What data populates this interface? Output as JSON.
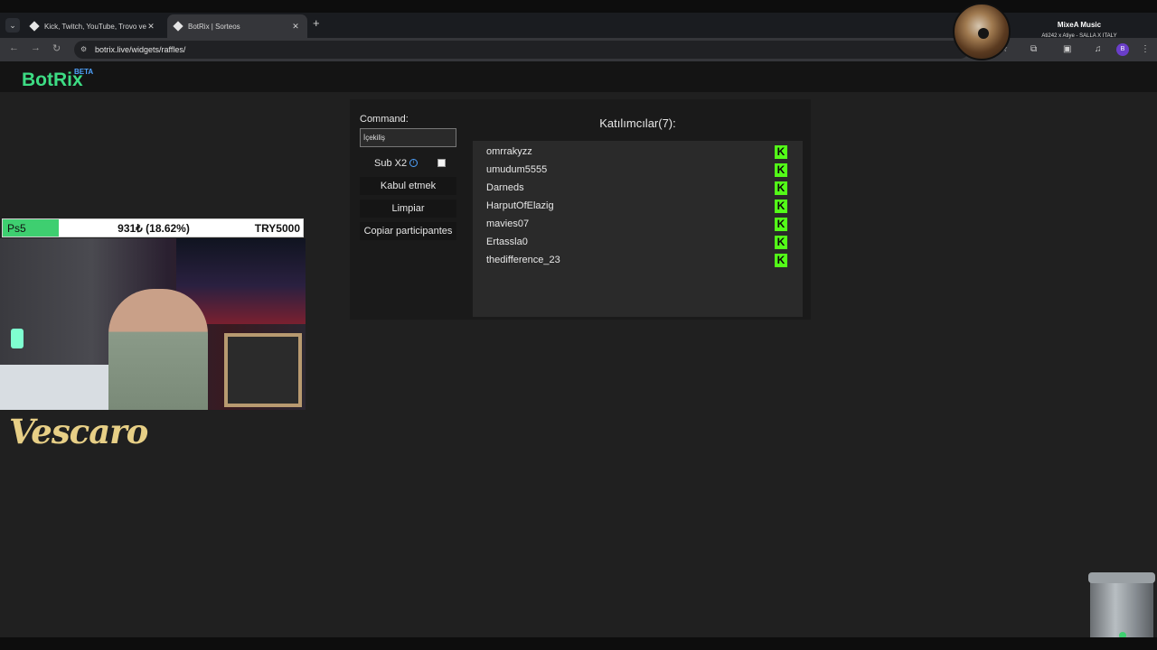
{
  "browser": {
    "tabs": [
      {
        "label": "Kick, Twitch, YouTube, Trovo ve"
      },
      {
        "label": "BotRix | Sorteos"
      }
    ],
    "url": "botrix.live/widgets/raffles/"
  },
  "music": {
    "title": "MixeA Music",
    "artist": "Ati242 x Atiye - SALLA X ITALY"
  },
  "site": {
    "logo": "BotRix",
    "beta": "BETA"
  },
  "raffle": {
    "command_label": "Command:",
    "command_value": "İçekiliş",
    "sub_label": "Sub X2",
    "sub_checked": false,
    "buttons": [
      "Kabul etmek",
      "Limpiar",
      "Copiar participantes"
    ],
    "participants_title": "Katılımcılar(7):",
    "participants": [
      "omrrakyzz",
      "umudum5555",
      "Darneds",
      "HarputOfElazig",
      "mavies07",
      "Ertassla0",
      "thedifference_23"
    ],
    "platform_badge": "K",
    "platform_color": "#53fc18"
  },
  "stream": {
    "goal_name": "Ps5",
    "goal_value": "931₺ (18.62%)",
    "goal_target": "TRY5000",
    "goal_progress_pct": 18.62,
    "streamer_name": "Vescaro"
  },
  "colors": {
    "logo": "#3ddc84",
    "beta": "#4fa3ff",
    "goal_fill": "#3ecf70",
    "kick": "#53fc18"
  }
}
